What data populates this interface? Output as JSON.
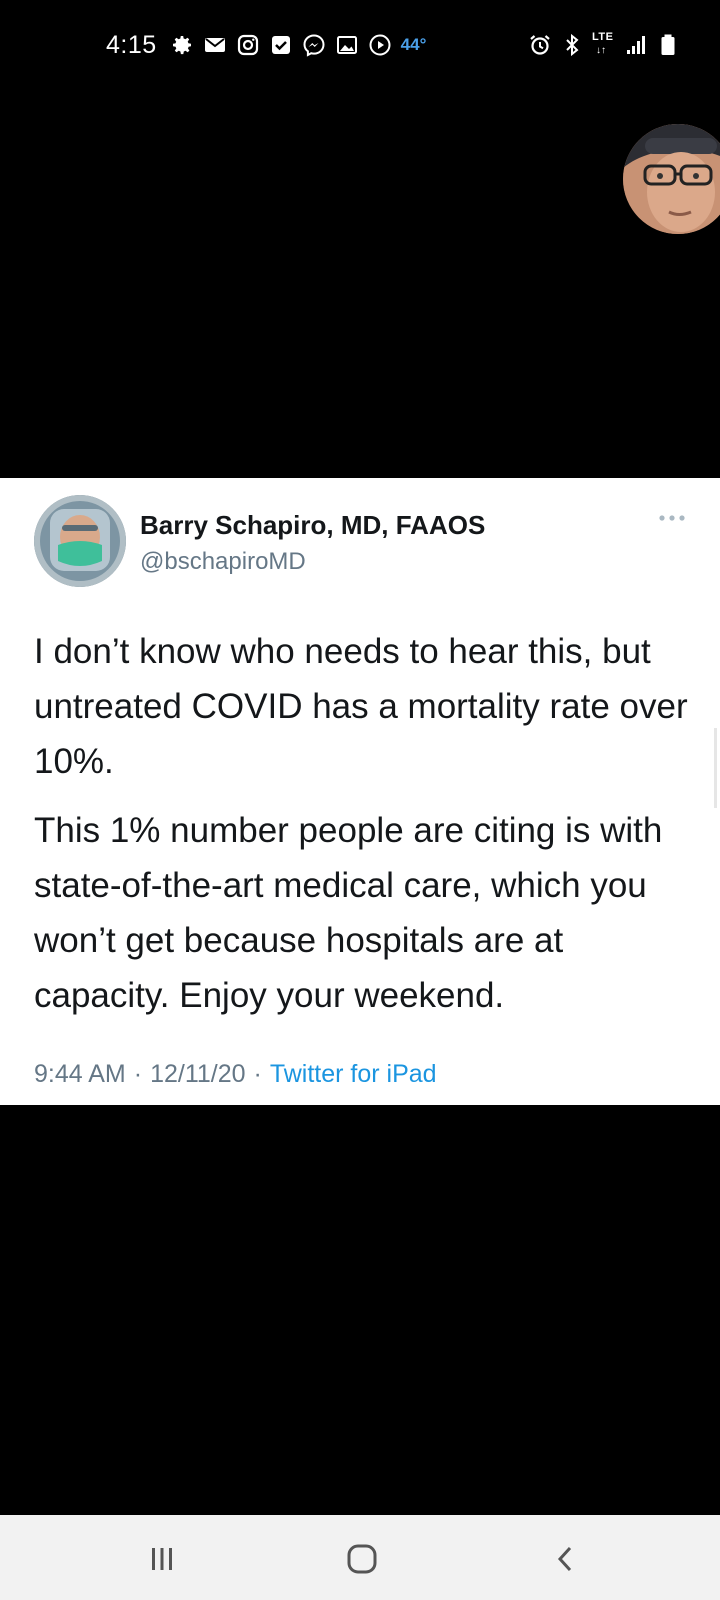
{
  "status_bar": {
    "time": "4:15",
    "temperature": "44°",
    "network": "LTE",
    "left_icons": [
      "settings-icon",
      "gmail-icon",
      "instagram-icon",
      "checkbox-icon",
      "messenger-icon",
      "gallery-icon",
      "media-play-icon"
    ],
    "right_icons": [
      "alarm-icon",
      "bluetooth-icon",
      "lte-icon",
      "signal-icon",
      "battery-icon"
    ]
  },
  "tweet": {
    "display_name": "Barry Schapiro, MD, FAAOS",
    "handle": "@bschapiroMD",
    "paragraphs": [
      "I don’t know who needs to hear this, but untreated COVID has a mortality rate over 10%.",
      "This 1% number people are citing is with state-of-the-art medical care, which you won’t get because hospitals are at capacity.  Enjoy your weekend."
    ],
    "time": "9:44 AM",
    "separator": "·",
    "date": "12/11/20",
    "source": "Twitter for iPad"
  },
  "colors": {
    "background": "#000000",
    "card": "#ffffff",
    "text": "#14171a",
    "secondary_text": "#657786",
    "link": "#1b95e0",
    "temperature": "#4a9fe8",
    "nav_bar": "#f2f2f2"
  },
  "navigation": {
    "buttons": [
      "recent-apps-icon",
      "home-icon",
      "back-icon"
    ]
  }
}
